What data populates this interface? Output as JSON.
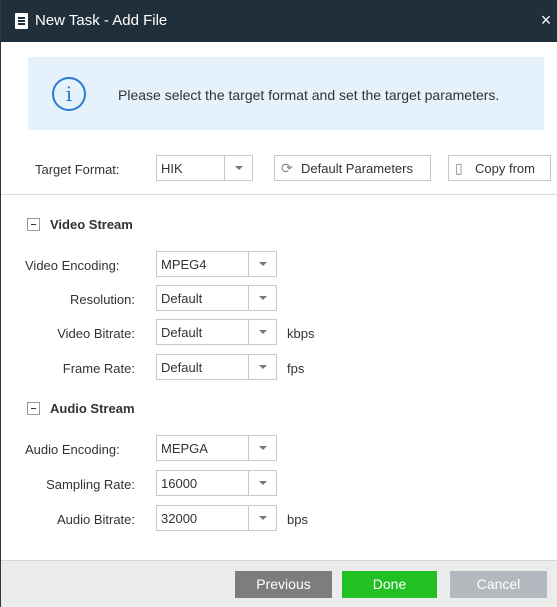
{
  "dialog": {
    "title": "New Task - Add File",
    "close_glyph": "×"
  },
  "info": {
    "icon_glyph": "i",
    "message": "Please select the target format and set the target parameters."
  },
  "format_row": {
    "label": "Target Format:",
    "value": "HIK",
    "default_params_label": "Default Parameters",
    "copy_from_label": "Copy from"
  },
  "video_section": {
    "title": "Video Stream",
    "fields": [
      {
        "label": "Video Encoding:",
        "value": "MPEG4",
        "unit": ""
      },
      {
        "label": "Resolution:",
        "value": "Default",
        "unit": ""
      },
      {
        "label": "Video Bitrate:",
        "value": "Default",
        "unit": "kbps"
      },
      {
        "label": "Frame Rate:",
        "value": "Default",
        "unit": "fps"
      }
    ]
  },
  "audio_section": {
    "title": "Audio Stream",
    "fields": [
      {
        "label": "Audio Encoding:",
        "value": "MEPGA",
        "unit": ""
      },
      {
        "label": "Sampling Rate:",
        "value": "16000",
        "unit": ""
      },
      {
        "label": "Audio Bitrate:",
        "value": "32000",
        "unit": "bps"
      }
    ]
  },
  "footer": {
    "previous_label": "Previous",
    "done_label": "Done",
    "cancel_label": "Cancel"
  },
  "colors": {
    "titlebar": "#1f2f3c",
    "info_bg": "#e5f1fb",
    "info_icon": "#2b7bd1",
    "done": "#22c022",
    "previous": "#7d7d7d",
    "cancel": "#b3b9bf"
  },
  "icons": {
    "title": "document-icon",
    "close": "close-icon",
    "info": "info-icon",
    "default_params": "refresh-icon",
    "copy_from": "copy-icon"
  }
}
